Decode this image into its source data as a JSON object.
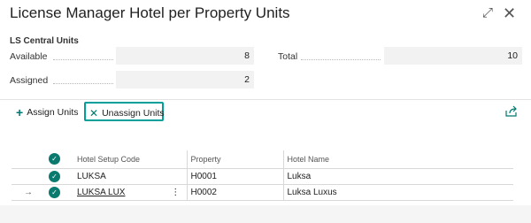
{
  "window": {
    "title": "License Manager Hotel per Property Units",
    "expand_glyph": "⤢",
    "close_glyph": "✕"
  },
  "units": {
    "group_title": "LS Central Units",
    "available_label": "Available",
    "available_value": "8",
    "total_label": "Total",
    "total_value": "10",
    "assigned_label": "Assigned",
    "assigned_value": "2"
  },
  "toolbar": {
    "assign_label": "Assign Units",
    "unassign_label": "Unassign Units",
    "plus_glyph": "+",
    "x_glyph": "✕"
  },
  "table": {
    "headers": {
      "setup_code": "Hotel Setup Code",
      "property": "Property",
      "hotel_name": "Hotel Name"
    },
    "rows": [
      {
        "setup_code": "LUKSA",
        "property": "H0001",
        "hotel_name": "Luksa"
      },
      {
        "setup_code": "LUKSA LUX",
        "property": "H0002",
        "hotel_name": "Luksa Luxus"
      }
    ],
    "check_glyph": "✓",
    "row_arrow": "→",
    "row_menu": "⋮"
  },
  "colors": {
    "accent": "#00786f",
    "highlight_border": "#00a09a"
  }
}
